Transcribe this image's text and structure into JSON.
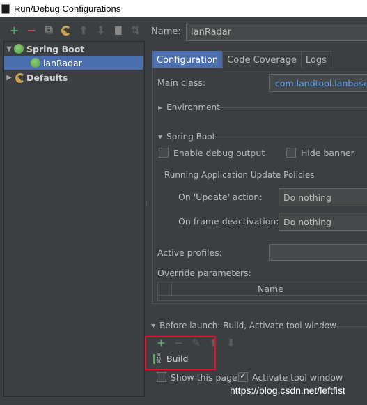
{
  "window": {
    "title": "Run/Debug Configurations"
  },
  "toolbar": {
    "buttons": [
      {
        "name": "add-button",
        "glyph": "+"
      },
      {
        "name": "remove-button",
        "glyph": "−"
      },
      {
        "name": "copy-button",
        "glyph": "⧉"
      },
      {
        "name": "edit-defaults-button",
        "glyph": "🔧"
      },
      {
        "name": "move-up-button",
        "glyph": "⬆"
      },
      {
        "name": "move-down-button",
        "glyph": "⬇"
      },
      {
        "name": "folder-button",
        "glyph": "▇"
      },
      {
        "name": "sort-button",
        "glyph": "⇅"
      }
    ]
  },
  "tree": {
    "spring_boot": "Spring Boot",
    "lanradar": "lanRadar",
    "defaults": "Defaults"
  },
  "name": {
    "label": "Name:",
    "value": "lanRadar"
  },
  "tabs": [
    "Configuration",
    "Code Coverage",
    "Logs"
  ],
  "config": {
    "main_class_label": "Main class:",
    "main_class_value": "com.landtool.lanbase.L",
    "environment": "Environment",
    "spring_boot": "Spring Boot",
    "enable_debug": "Enable debug output",
    "hide_banner": "Hide banner",
    "policies": "Running Application Update Policies",
    "on_update_label": "On 'Update' action:",
    "on_update_value": "Do nothing",
    "on_frame_label": "On frame deactivation:",
    "on_frame_value": "Do nothing",
    "active_profiles": "Active profiles:",
    "override_params": "Override parameters:",
    "params_name_col": "Name"
  },
  "before_launch": {
    "title": "Before launch: Build, Activate tool window",
    "build": "Build",
    "build_icon": "01\n10\n01",
    "show_page": "Show this page",
    "activate_tool": "Activate tool window",
    "show_page_checked": false,
    "activate_tool_checked": true
  },
  "watermark": "https://blog.csdn.net/leftfist"
}
